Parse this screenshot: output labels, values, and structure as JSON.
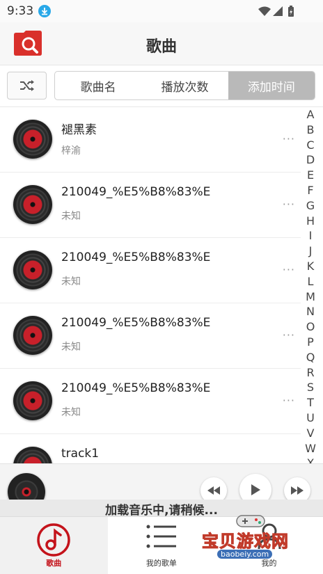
{
  "status": {
    "time": "9:33"
  },
  "app": {
    "title": "歌曲"
  },
  "sort_tabs": [
    "歌曲名",
    "播放次数",
    "添加时间"
  ],
  "songs": [
    {
      "title": "褪黑素",
      "artist": "梓渝"
    },
    {
      "title": "210049_%E5%B8%83%E",
      "artist": "未知"
    },
    {
      "title": "210049_%E5%B8%83%E",
      "artist": "未知"
    },
    {
      "title": "210049_%E5%B8%83%E",
      "artist": "未知"
    },
    {
      "title": "210049_%E5%B8%83%E",
      "artist": "未知"
    },
    {
      "title": "track1",
      "artist": ""
    }
  ],
  "index_letters": [
    "A",
    "B",
    "C",
    "D",
    "E",
    "F",
    "G",
    "H",
    "I",
    "J",
    "K",
    "L",
    "M",
    "N",
    "O",
    "P",
    "Q",
    "R",
    "S",
    "T",
    "U",
    "V",
    "W",
    "X"
  ],
  "player": {
    "status": "加载音乐中,请稍候..."
  },
  "bottom_nav": {
    "songs_label": "歌曲",
    "playlists_label": "我的歌单",
    "mine_label": "我的"
  },
  "watermark": {
    "name": "宝贝游戏网",
    "url": "baobeiy.com"
  },
  "colors": {
    "accent": "#c4131b",
    "active_tab": "#b9b9b9"
  },
  "icons": [
    "download-icon",
    "wifi-icon",
    "signal-icon",
    "battery-icon",
    "search-icon",
    "shuffle-icon",
    "more-icon",
    "rewind-icon",
    "play-icon",
    "fast-forward-icon",
    "music-note-icon",
    "list-icon",
    "user-icon"
  ]
}
